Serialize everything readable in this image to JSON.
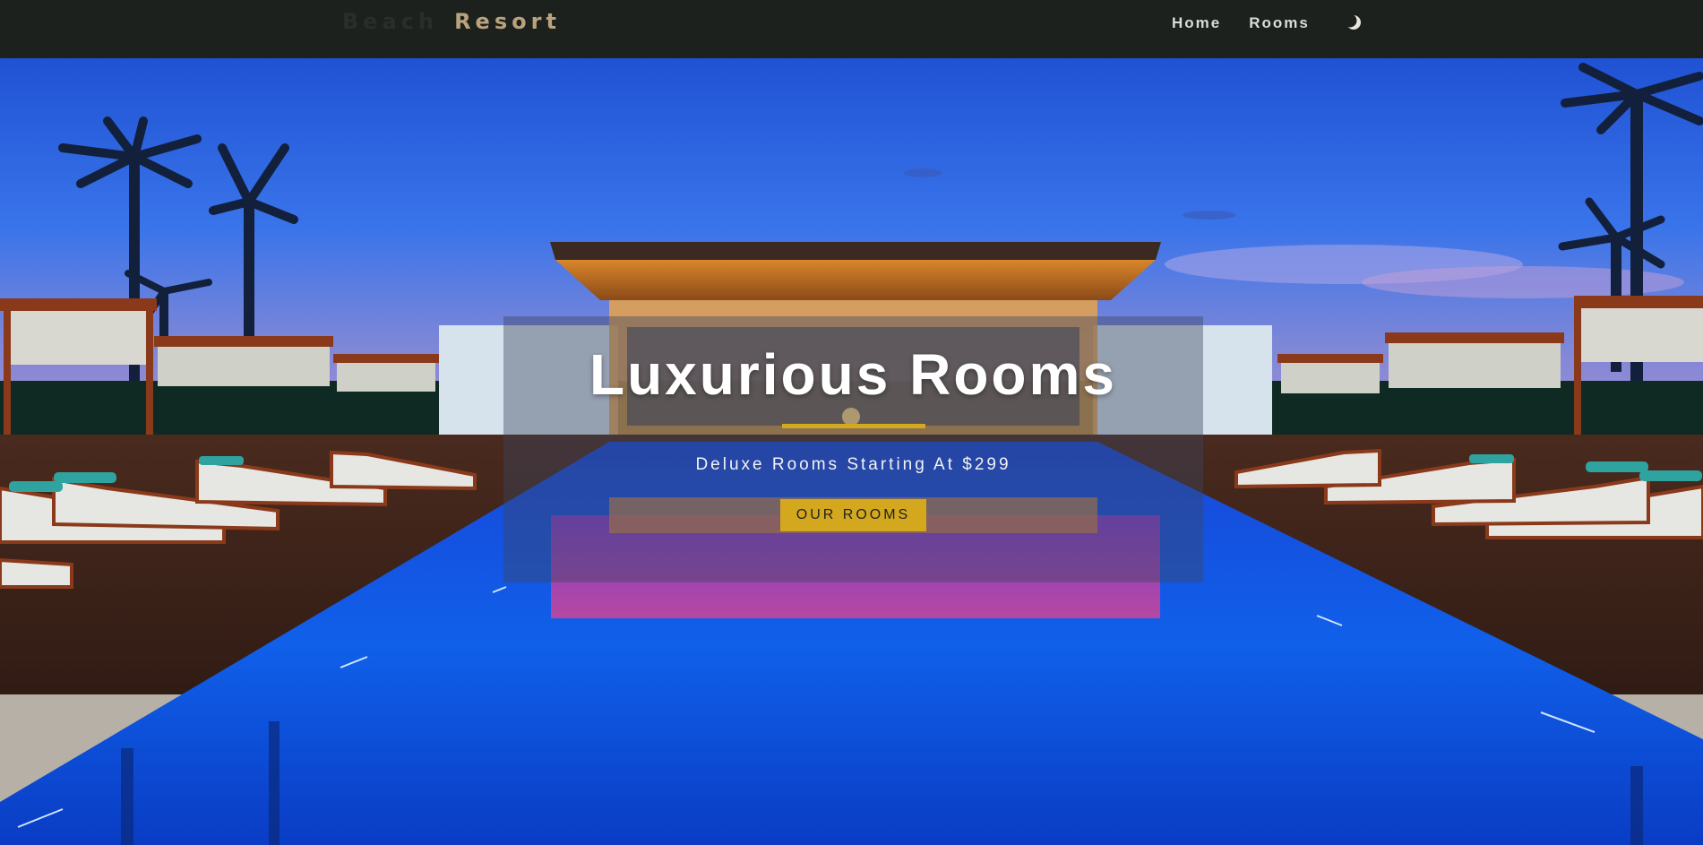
{
  "navbar": {
    "brand_part1": "Beach",
    "brand_part2": "Resort",
    "links": [
      {
        "label": "Home"
      },
      {
        "label": "Rooms"
      }
    ],
    "theme_icon": "moon-icon"
  },
  "hero": {
    "background_image": "resort-pool-at-dusk",
    "banner": {
      "title": "Luxurious Rooms",
      "subtitle": "Deluxe Rooms Starting At $299",
      "button_label": "OUR ROOMS"
    }
  },
  "colors": {
    "navbar_bg": "#1c211e",
    "brand_accent": "#b9a27d",
    "accent": "#d3a81f",
    "nav_text": "#d9dcda"
  }
}
